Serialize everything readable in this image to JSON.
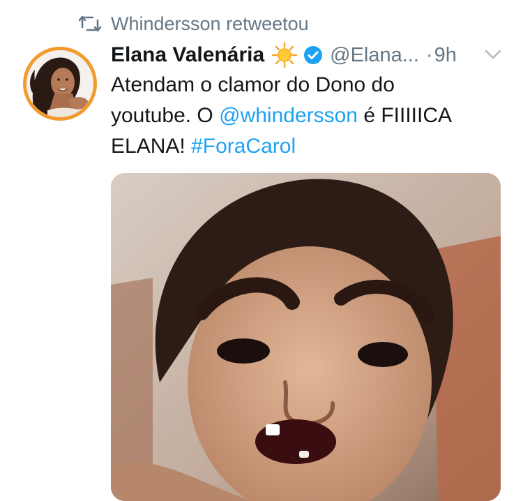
{
  "retweet": {
    "icon": "retweet-icon",
    "text": "Whindersson retweetou"
  },
  "tweet": {
    "author_name": "Elana Valenária",
    "emoji_icon": "sun-emoji-icon",
    "verified_icon": "verified-badge-icon",
    "handle": "@Elana...",
    "separator": "·",
    "time": "9h",
    "menu_icon": "chevron-down-icon",
    "text": {
      "line1": "Atendam o clamor do Dono do",
      "line2_pre": "youtube. O ",
      "mention": "@whindersson",
      "line2_post": " é FIIIIICA",
      "line3_pre": "ELANA! ",
      "hashtag": "#ForaCarol"
    },
    "colors": {
      "link": "#1da1f2",
      "secondary": "#657786",
      "primary": "#14171a",
      "avatar_ring": "#f39a2d"
    }
  }
}
